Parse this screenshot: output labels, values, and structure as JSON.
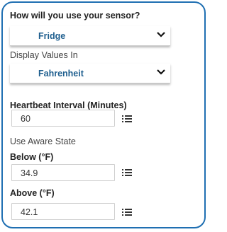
{
  "usage": {
    "question": "How will you use your sensor?",
    "selected": "Fridge"
  },
  "display_values": {
    "label": "Display Values In",
    "selected": "Fahrenheit"
  },
  "heartbeat": {
    "label": "Heartbeat Interval (Minutes)",
    "value": "60"
  },
  "aware_state": {
    "label": "Use Aware State"
  },
  "below": {
    "label": "Below (°F)",
    "value": "34.9"
  },
  "above": {
    "label": "Above (°F)",
    "value": "42.1"
  },
  "icons": {
    "chevron": "chevron-down-icon",
    "list": "list-icon"
  }
}
